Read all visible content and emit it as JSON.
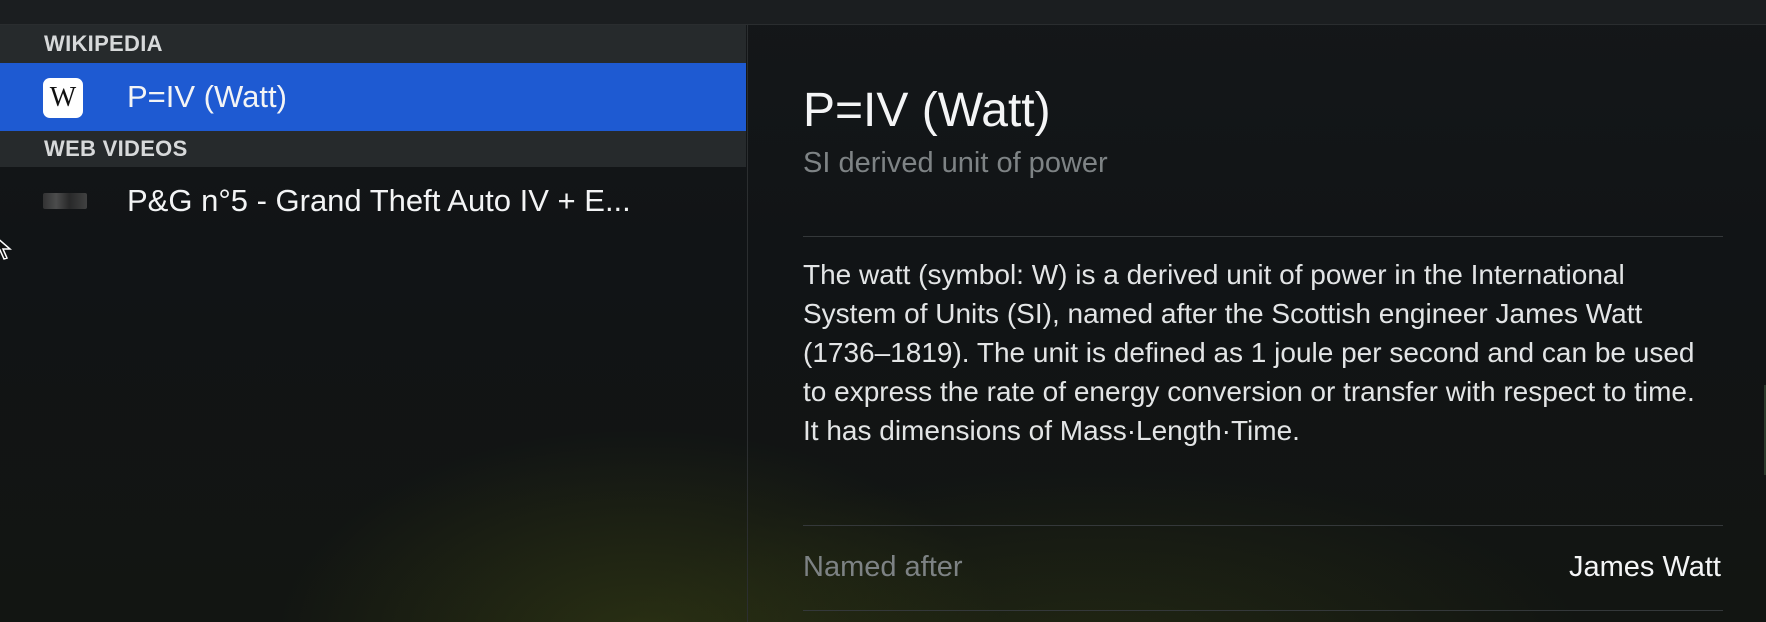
{
  "results": {
    "sections": [
      {
        "header": "WIKIPEDIA",
        "items": [
          {
            "label": "P=IV (Watt)",
            "icon": "wikipedia-icon",
            "icon_glyph": "W",
            "selected": true
          }
        ]
      },
      {
        "header": "WEB VIDEOS",
        "items": [
          {
            "label": "P&G n°5 - Grand Theft Auto IV + E...",
            "icon": "video-thumbnail-icon",
            "selected": false
          }
        ]
      }
    ]
  },
  "detail": {
    "title": "P=IV (Watt)",
    "subtitle": "SI derived unit of power",
    "body": "The watt (symbol: W) is a derived unit of power in the International System of Units (SI), named after the Scottish engineer James Watt (1736–1819). The unit is defined as 1 joule per second and can be used to express the rate of energy conversion or transfer with respect to time. It has dimensions of Mass·Length·Time.",
    "properties": [
      {
        "label": "Named after",
        "value": "James Watt"
      }
    ]
  },
  "colors": {
    "selection": "#1e5ad2",
    "section_header_bg": "#262a2c",
    "panel_bg": "#111416",
    "secondary_text": "#7e8385"
  }
}
